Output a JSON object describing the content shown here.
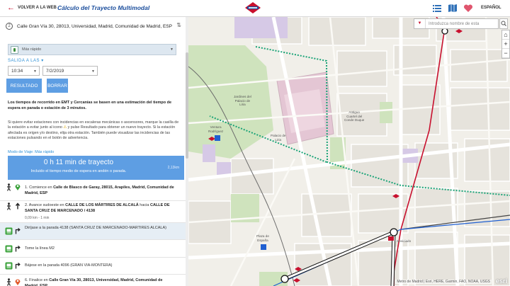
{
  "header": {
    "back_label": "VOLVER A LA WEB",
    "title": "Cálculo del Trayecto Multimodal",
    "language": "ESPAÑOL"
  },
  "form": {
    "destination": "Calle Gran Vía 30, 28013, Universidad, Madrid, Comunidad de Madrid, ESP",
    "destination_index": "2",
    "mode": "Más rápido",
    "departure_label": "SALIDA A LAS",
    "time": "10:34",
    "date": "7/2/2019",
    "result_button": "RESULTADO",
    "clear_button": "BORRAR"
  },
  "info": {
    "bold": "Los tiempos de recorrido en EMT y Cercanías se basen en una estimación del tiempo de espera en parada o estación de 3 minutos.",
    "text_a": "Si quiere evitar estaciones con incidencias en escaleras mecánicas o ascensores, marque la casilla de la estación a evitar junto al icono",
    "text_b": "y pulse Resultado para obtener un nuevo trayecto. Si la estación afectada es origen y/o destino, elija otra estación. También puede visualizar las incidencias de las estaciones pulsando en el botón de advertencia."
  },
  "route": {
    "mode_label": "Modo de Viaje: Más rápido",
    "duration": "0 h 11 min de trayecto",
    "subtitle": "Incluido el tiempo medio de espera en andén o parada.",
    "distance": "2,13km",
    "steps": [
      {
        "pre": "1. Comience en ",
        "bold": "Calle de Blasco de Garay, 28015, Arapiles, Madrid, Comunidad de Madrid, ESP",
        "post": ""
      },
      {
        "pre": "2. Avance sudoeste en ",
        "bold": "CALLE DE LOS MÁRTIRES DE ALCALÁ",
        "mid": " hacia ",
        "bold2": "CALLE DE SANTA CRUZ DE MARCENADO / 4138",
        "dist": "0,09 km - 1 min"
      },
      {
        "text": "Diríjase a la parada 4138 (SANTA CRUZ DE MARCENADO-MARTIRES ALCALA)"
      },
      {
        "text": "Tome la línea M2"
      },
      {
        "text": "Bájese en la parada 4096 (GRAN VIA-MONTERA)"
      },
      {
        "pre": "6. Finalice en ",
        "bold": "Calle Gran Vía 30, 28013, Universidad, Madrid, Comunidad de Madrid, ESP",
        "post": ""
      }
    ]
  },
  "map": {
    "search_placeholder": "Introduzca nombre de esta",
    "attribution": "Metro de Madrid | Esri, HERE, Garmin, FAO, NOAA, USGS",
    "esri_logo": "esri",
    "pois": {
      "ventura": "Ventura\nRodríguez",
      "jardines": "Jardines del\nPalacio de\nLiria",
      "palacio": "Palacio de\nLiria",
      "antiguo": "Antiguo\nCuartel del\nConde Duque",
      "plaza": "Plaza de\nEspaña",
      "noviciado": "Noviciado"
    },
    "zoom_in": "+",
    "zoom_out": "−"
  },
  "colors": {
    "accent_blue": "#5e9ee3",
    "metro_red": "#c8102e",
    "title_blue": "#1a4d9c"
  }
}
